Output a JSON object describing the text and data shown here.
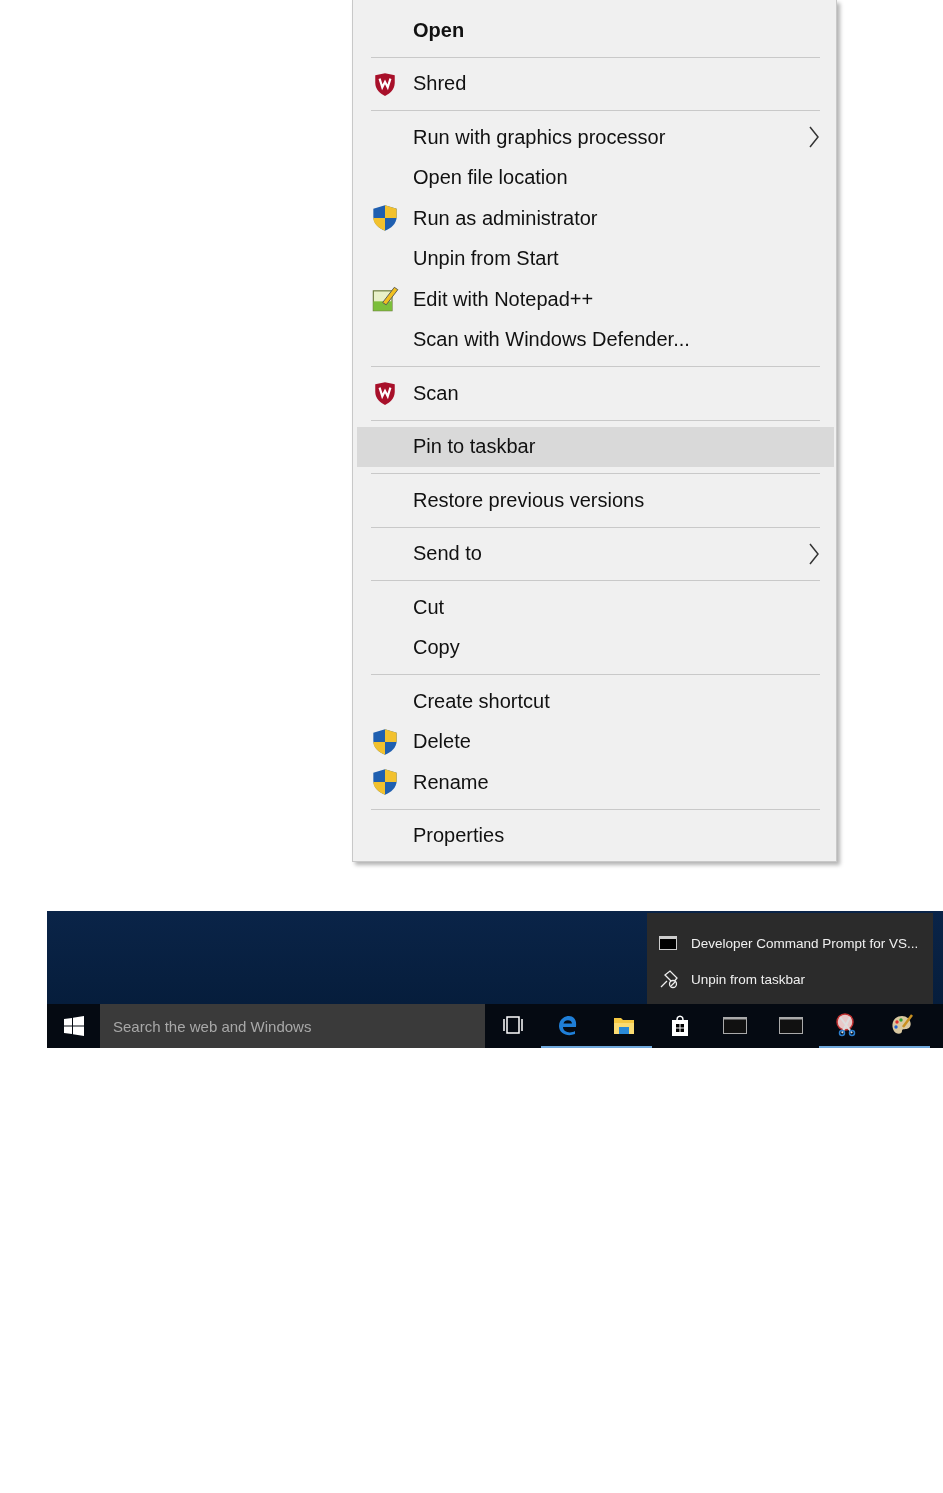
{
  "context_menu": {
    "items": [
      {
        "kind": "item",
        "label": "Open",
        "default": true,
        "submenu": false,
        "selected": false
      },
      {
        "kind": "separator"
      },
      {
        "kind": "item",
        "label": "Shred",
        "default": false,
        "submenu": false,
        "selected": false
      },
      {
        "kind": "separator"
      },
      {
        "kind": "item",
        "label": "Run with graphics processor",
        "default": false,
        "submenu": true,
        "selected": false
      },
      {
        "kind": "item",
        "label": "Open file location",
        "default": false,
        "submenu": false,
        "selected": false
      },
      {
        "kind": "item",
        "label": "Run as administrator",
        "default": false,
        "submenu": false,
        "selected": false
      },
      {
        "kind": "item",
        "label": "Unpin from Start",
        "default": false,
        "submenu": false,
        "selected": false
      },
      {
        "kind": "item",
        "label": "Edit with Notepad++",
        "default": false,
        "submenu": false,
        "selected": false
      },
      {
        "kind": "item",
        "label": "Scan with Windows Defender...",
        "default": false,
        "submenu": false,
        "selected": false
      },
      {
        "kind": "separator"
      },
      {
        "kind": "item",
        "label": "Scan",
        "default": false,
        "submenu": false,
        "selected": false
      },
      {
        "kind": "separator"
      },
      {
        "kind": "item",
        "label": "Pin to taskbar",
        "default": false,
        "submenu": false,
        "selected": true
      },
      {
        "kind": "separator"
      },
      {
        "kind": "item",
        "label": "Restore previous versions",
        "default": false,
        "submenu": false,
        "selected": false
      },
      {
        "kind": "separator"
      },
      {
        "kind": "item",
        "label": "Send to",
        "default": false,
        "submenu": true,
        "selected": false
      },
      {
        "kind": "separator"
      },
      {
        "kind": "item",
        "label": "Cut",
        "default": false,
        "submenu": false,
        "selected": false
      },
      {
        "kind": "item",
        "label": "Copy",
        "default": false,
        "submenu": false,
        "selected": false
      },
      {
        "kind": "separator"
      },
      {
        "kind": "item",
        "label": "Create shortcut",
        "default": false,
        "submenu": false,
        "selected": false
      },
      {
        "kind": "item",
        "label": "Delete",
        "default": false,
        "submenu": false,
        "selected": false
      },
      {
        "kind": "item",
        "label": "Rename",
        "default": false,
        "submenu": false,
        "selected": false
      },
      {
        "kind": "separator"
      },
      {
        "kind": "item",
        "label": "Properties",
        "default": false,
        "submenu": false,
        "selected": false
      }
    ]
  },
  "jump_list": {
    "items": [
      {
        "kind": "app",
        "label": "Developer Command Prompt for VS..."
      },
      {
        "kind": "unpin",
        "label": "Unpin from taskbar"
      }
    ]
  },
  "taskbar": {
    "search": {
      "placeholder": "Search the web and Windows"
    },
    "icons": [
      {
        "kind": "task-view",
        "running": false
      },
      {
        "kind": "edge",
        "running": true
      },
      {
        "kind": "explorer",
        "running": true
      },
      {
        "kind": "store",
        "running": false
      },
      {
        "kind": "console",
        "running": false
      },
      {
        "kind": "console",
        "running": false
      },
      {
        "kind": "snipping",
        "running": true
      },
      {
        "kind": "paint",
        "running": true
      }
    ]
  }
}
